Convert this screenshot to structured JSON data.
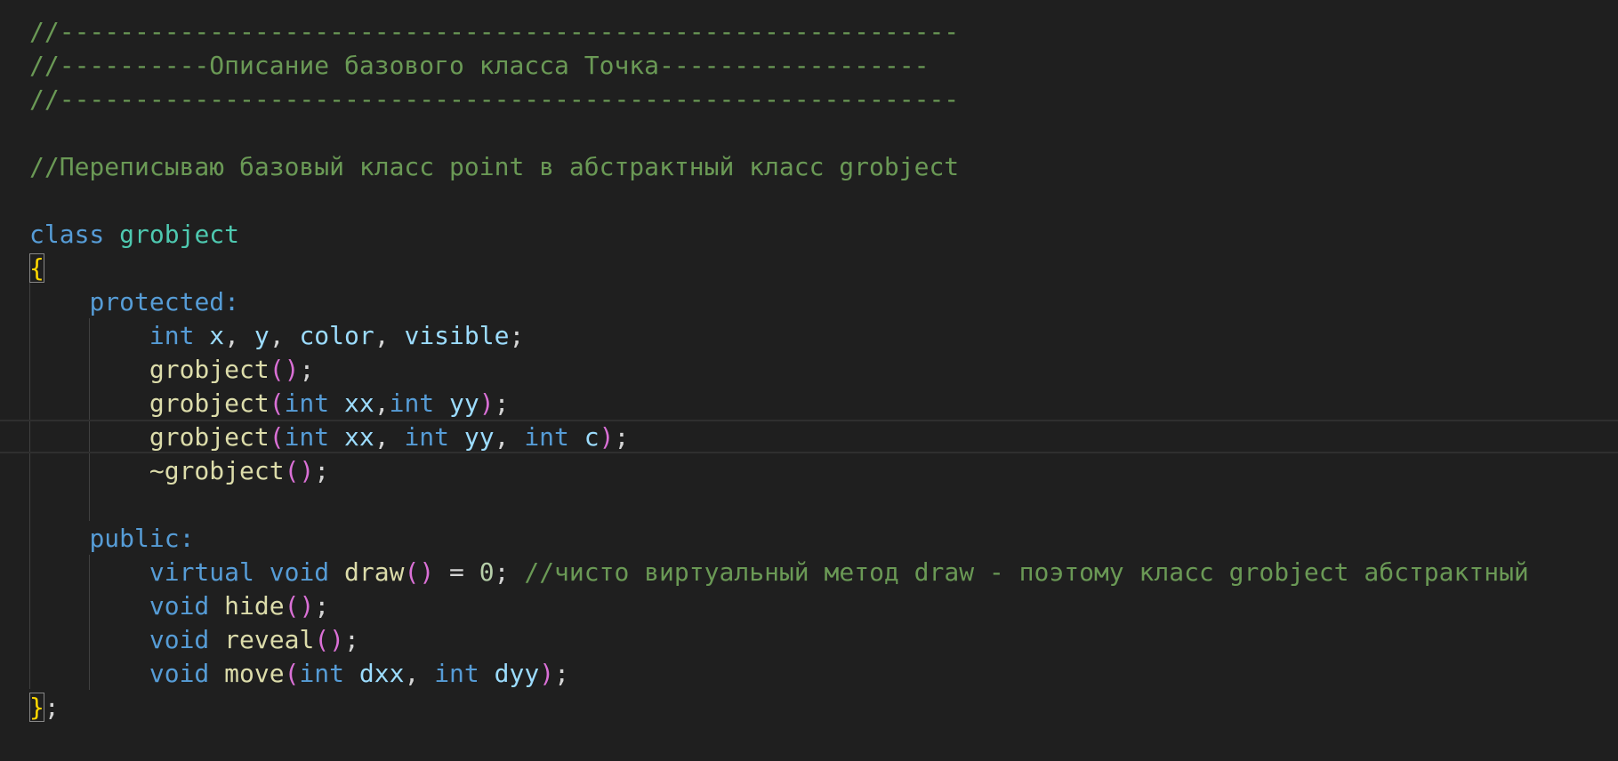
{
  "colors": {
    "background": "#1f1f1f",
    "comment": "#6a9955",
    "keyword": "#569cd6",
    "class_name": "#4ec9b0",
    "function": "#dcdcaa",
    "variable": "#9cdcfe",
    "punctuation": "#d4d4d4",
    "brace": "#ffd700",
    "paren": "#da70d6",
    "number": "#b5cea8",
    "indent_guide": "#404040"
  },
  "lines": [
    {
      "tokens": [
        {
          "t": "//------------------------------------------------------------",
          "c": "comment"
        }
      ]
    },
    {
      "tokens": [
        {
          "t": "//----------Описание базового класса Точка------------------",
          "c": "comment"
        }
      ]
    },
    {
      "tokens": [
        {
          "t": "//------------------------------------------------------------",
          "c": "comment"
        }
      ]
    },
    {
      "tokens": []
    },
    {
      "tokens": [
        {
          "t": "//Переписываю базовый класс point в абстрактный класс grobject",
          "c": "comment"
        }
      ]
    },
    {
      "tokens": []
    },
    {
      "tokens": [
        {
          "t": "class",
          "c": "keyword"
        },
        {
          "t": " ",
          "c": "punctuation"
        },
        {
          "t": "grobject",
          "c": "class_name"
        }
      ]
    },
    {
      "tokens": [
        {
          "t": "{",
          "c": "brace",
          "box": true
        }
      ]
    },
    {
      "tokens": [
        {
          "t": "    ",
          "c": "punctuation"
        },
        {
          "t": "protected:",
          "c": "keyword"
        }
      ]
    },
    {
      "tokens": [
        {
          "t": "        ",
          "c": "punctuation"
        },
        {
          "t": "int",
          "c": "keyword"
        },
        {
          "t": " ",
          "c": "punctuation"
        },
        {
          "t": "x",
          "c": "variable"
        },
        {
          "t": ", ",
          "c": "punctuation"
        },
        {
          "t": "y",
          "c": "variable"
        },
        {
          "t": ", ",
          "c": "punctuation"
        },
        {
          "t": "color",
          "c": "variable"
        },
        {
          "t": ", ",
          "c": "punctuation"
        },
        {
          "t": "visible",
          "c": "variable"
        },
        {
          "t": ";",
          "c": "punctuation"
        }
      ]
    },
    {
      "tokens": [
        {
          "t": "        ",
          "c": "punctuation"
        },
        {
          "t": "grobject",
          "c": "function"
        },
        {
          "t": "()",
          "c": "paren"
        },
        {
          "t": ";",
          "c": "punctuation"
        }
      ]
    },
    {
      "tokens": [
        {
          "t": "        ",
          "c": "punctuation"
        },
        {
          "t": "grobject",
          "c": "function"
        },
        {
          "t": "(",
          "c": "paren"
        },
        {
          "t": "int",
          "c": "keyword"
        },
        {
          "t": " ",
          "c": "punctuation"
        },
        {
          "t": "xx",
          "c": "variable"
        },
        {
          "t": ",",
          "c": "punctuation"
        },
        {
          "t": "int",
          "c": "keyword"
        },
        {
          "t": " ",
          "c": "punctuation"
        },
        {
          "t": "yy",
          "c": "variable"
        },
        {
          "t": ")",
          "c": "paren"
        },
        {
          "t": ";",
          "c": "punctuation"
        }
      ]
    },
    {
      "current": true,
      "tokens": [
        {
          "t": "        ",
          "c": "punctuation"
        },
        {
          "t": "grobject",
          "c": "function"
        },
        {
          "t": "(",
          "c": "paren"
        },
        {
          "t": "int",
          "c": "keyword"
        },
        {
          "t": " ",
          "c": "punctuation"
        },
        {
          "t": "xx",
          "c": "variable"
        },
        {
          "t": ", ",
          "c": "punctuation"
        },
        {
          "t": "int",
          "c": "keyword"
        },
        {
          "t": " ",
          "c": "punctuation"
        },
        {
          "t": "yy",
          "c": "variable"
        },
        {
          "t": ", ",
          "c": "punctuation"
        },
        {
          "t": "int",
          "c": "keyword"
        },
        {
          "t": " ",
          "c": "punctuation"
        },
        {
          "t": "c",
          "c": "variable"
        },
        {
          "t": ")",
          "c": "paren"
        },
        {
          "t": ";",
          "c": "punctuation"
        }
      ]
    },
    {
      "tokens": [
        {
          "t": "        ",
          "c": "punctuation"
        },
        {
          "t": "~grobject",
          "c": "function"
        },
        {
          "t": "()",
          "c": "paren"
        },
        {
          "t": ";",
          "c": "punctuation"
        }
      ]
    },
    {
      "tokens": []
    },
    {
      "tokens": [
        {
          "t": "    ",
          "c": "punctuation"
        },
        {
          "t": "public:",
          "c": "keyword"
        }
      ]
    },
    {
      "tokens": [
        {
          "t": "        ",
          "c": "punctuation"
        },
        {
          "t": "virtual",
          "c": "keyword"
        },
        {
          "t": " ",
          "c": "punctuation"
        },
        {
          "t": "void",
          "c": "keyword"
        },
        {
          "t": " ",
          "c": "punctuation"
        },
        {
          "t": "draw",
          "c": "function"
        },
        {
          "t": "()",
          "c": "paren"
        },
        {
          "t": " = ",
          "c": "punctuation"
        },
        {
          "t": "0",
          "c": "number"
        },
        {
          "t": "; ",
          "c": "punctuation"
        },
        {
          "t": "//чисто виртуальный метод draw - поэтому класс grobject абстрактный",
          "c": "comment"
        }
      ]
    },
    {
      "tokens": [
        {
          "t": "        ",
          "c": "punctuation"
        },
        {
          "t": "void",
          "c": "keyword"
        },
        {
          "t": " ",
          "c": "punctuation"
        },
        {
          "t": "hide",
          "c": "function"
        },
        {
          "t": "()",
          "c": "paren"
        },
        {
          "t": ";",
          "c": "punctuation"
        }
      ]
    },
    {
      "tokens": [
        {
          "t": "        ",
          "c": "punctuation"
        },
        {
          "t": "void",
          "c": "keyword"
        },
        {
          "t": " ",
          "c": "punctuation"
        },
        {
          "t": "reveal",
          "c": "function"
        },
        {
          "t": "()",
          "c": "paren"
        },
        {
          "t": ";",
          "c": "punctuation"
        }
      ]
    },
    {
      "tokens": [
        {
          "t": "        ",
          "c": "punctuation"
        },
        {
          "t": "void",
          "c": "keyword"
        },
        {
          "t": " ",
          "c": "punctuation"
        },
        {
          "t": "move",
          "c": "function"
        },
        {
          "t": "(",
          "c": "paren"
        },
        {
          "t": "int",
          "c": "keyword"
        },
        {
          "t": " ",
          "c": "punctuation"
        },
        {
          "t": "dxx",
          "c": "variable"
        },
        {
          "t": ", ",
          "c": "punctuation"
        },
        {
          "t": "int",
          "c": "keyword"
        },
        {
          "t": " ",
          "c": "punctuation"
        },
        {
          "t": "dyy",
          "c": "variable"
        },
        {
          "t": ")",
          "c": "paren"
        },
        {
          "t": ";",
          "c": "punctuation"
        }
      ]
    },
    {
      "tokens": [
        {
          "t": "}",
          "c": "brace",
          "box": true
        },
        {
          "t": ";",
          "c": "punctuation"
        }
      ]
    }
  ]
}
